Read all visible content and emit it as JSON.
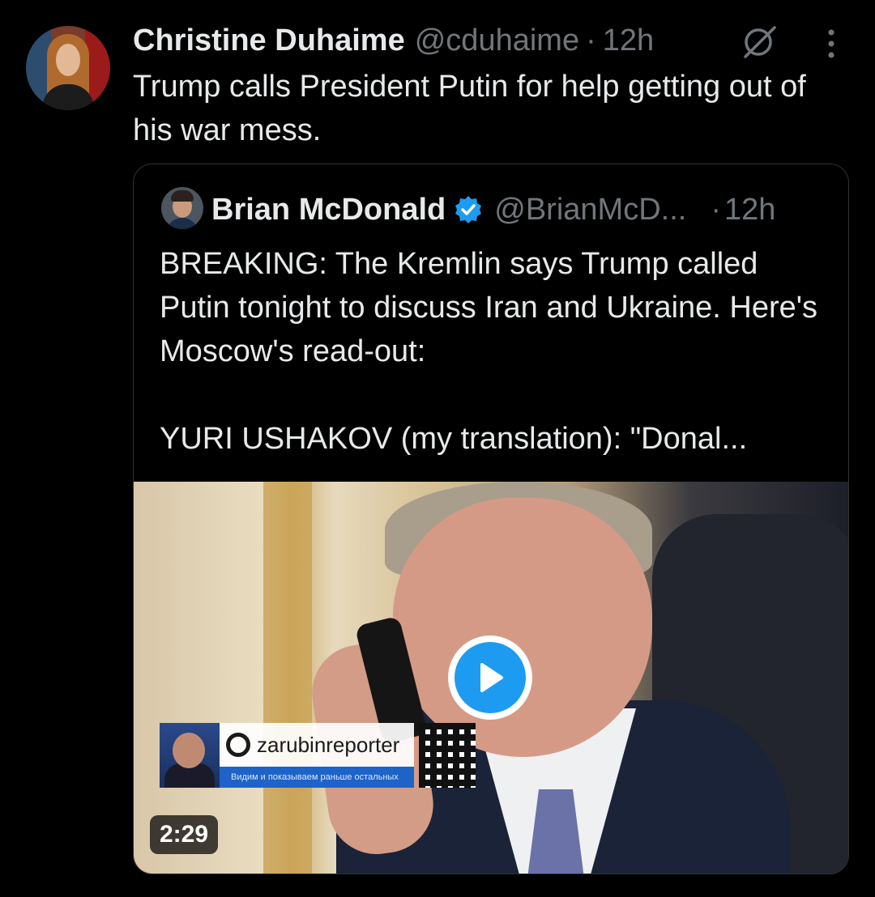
{
  "tweet": {
    "author_name": "Christine Duhaime",
    "author_handle": "@cduhaime",
    "separator": "·",
    "time": "12h",
    "text": "Trump calls President Putin for help getting out of his war mess.",
    "icons": [
      "grok-icon",
      "more-icon"
    ]
  },
  "quoted": {
    "author_name": "Brian McDonald",
    "verified": true,
    "author_handle": "@BrianMcD...",
    "separator": "·",
    "time": "12h",
    "text": "BREAKING: The Kremlin says Trump called Putin tonight to discuss Iran and Ukraine. Here's Moscow's read-out:\n\nYURI USHAKOV (my translation): \"Donal...",
    "video": {
      "duration": "2:29",
      "overlay_channel": "zarubinreporter",
      "overlay_tagline": "Видим и показываем раньше остальных"
    }
  },
  "colors": {
    "background": "#000000",
    "primary_text": "#e7e9ea",
    "secondary_text": "#71767b",
    "accent": "#1d9bf0",
    "border": "#2f3336"
  }
}
